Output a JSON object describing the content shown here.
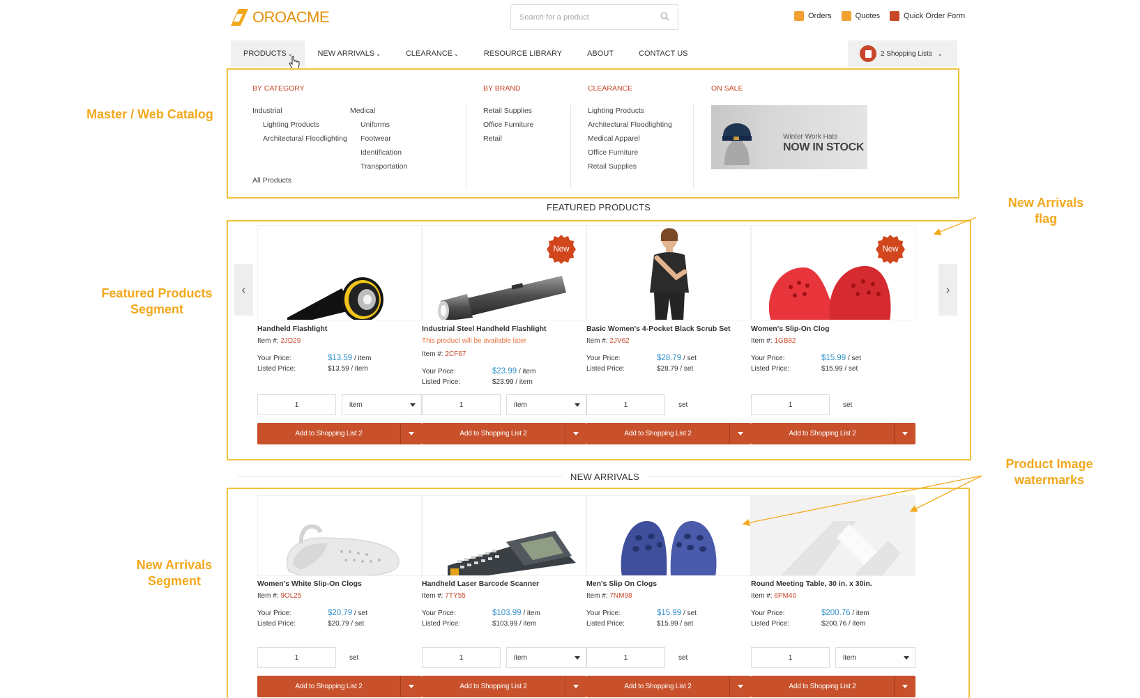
{
  "brand": {
    "name": "OROACME"
  },
  "search": {
    "placeholder": "Search for a product"
  },
  "header_links": [
    {
      "label": "Orders"
    },
    {
      "label": "Quotes"
    },
    {
      "label": "Quick Order Form"
    }
  ],
  "nav": {
    "items": [
      {
        "label": "PRODUCTS"
      },
      {
        "label": "NEW ARRIVALS"
      },
      {
        "label": "CLEARANCE"
      },
      {
        "label": "RESOURCE LIBRARY"
      },
      {
        "label": "ABOUT"
      },
      {
        "label": "CONTACT US"
      }
    ],
    "shopping_lists": "2 Shopping Lists"
  },
  "mega_menu": {
    "by_category": {
      "heading": "BY CATEGORY",
      "industrial": "Industrial",
      "industrial_children": [
        "Lighting Products",
        "Architectural Floodlighting"
      ],
      "medical": "Medical",
      "medical_children": [
        "Uniforms",
        "Footwear",
        "Identification",
        "Transportation"
      ],
      "all_products": "All Products"
    },
    "by_brand": {
      "heading": "BY BRAND",
      "items": [
        "Retail Supplies",
        "Office Furniture",
        "Retail"
      ]
    },
    "clearance": {
      "heading": "CLEARANCE",
      "items": [
        "Lighting Products",
        "Architectural Floodlighting",
        "Medical Apparel",
        "Office Furniture",
        "Retail Supplies"
      ]
    },
    "on_sale": {
      "heading": "ON SALE",
      "promo_line1": "Winter Work Hats",
      "promo_line2": "NOW IN STOCK"
    }
  },
  "labels": {
    "item_no": "Item #:",
    "your_price": "Your Price:",
    "listed_price": "Listed Price:",
    "add_button": "Add to Shopping List 2",
    "new_badge": "New",
    "qty": "1"
  },
  "featured": {
    "title": "FEATURED PRODUCTS",
    "products": [
      {
        "name": "Handheld Flashlight",
        "sku": "2JD29",
        "price": "$13.59",
        "price_unit": "/ item",
        "listed": "$13.59 / item",
        "unit": "item",
        "unit_select": false,
        "badge": false,
        "availability": ""
      },
      {
        "name": "Industrial Steel Handheld Flashlight",
        "sku": "2CF67",
        "price": "$23.99",
        "price_unit": "/ item",
        "listed": "$23.99 / item",
        "unit": "item",
        "unit_select": true,
        "badge": true,
        "availability": "This product will be available later"
      },
      {
        "name": "Basic Women's 4-Pocket Black Scrub Set",
        "sku": "2JV62",
        "price": "$28.79",
        "price_unit": "/ set",
        "listed": "$28.79 / set",
        "unit": "set",
        "unit_select": false,
        "badge": false,
        "availability": ""
      },
      {
        "name": "Women's Slip-On Clog",
        "sku": "1GB82",
        "price": "$15.99",
        "price_unit": "/ set",
        "listed": "$15.99 / set",
        "unit": "set",
        "unit_select": false,
        "badge": true,
        "availability": ""
      }
    ]
  },
  "new_arrivals": {
    "title": "NEW ARRIVALS",
    "products": [
      {
        "name": "Women's White Slip-On Clogs",
        "sku": "9OL25",
        "price": "$20.79",
        "price_unit": "/ set",
        "listed": "$20.79 / set",
        "unit": "set",
        "unit_select": false
      },
      {
        "name": "Handheld Laser Barcode Scanner",
        "sku": "7TY55",
        "price": "$103.99",
        "price_unit": "/ item",
        "listed": "$103.99 / item",
        "unit": "item",
        "unit_select": true
      },
      {
        "name": "Men's Slip On Clogs",
        "sku": "7NM98",
        "price": "$15.99",
        "price_unit": "/ set",
        "listed": "$15.99 / set",
        "unit": "set",
        "unit_select": false
      },
      {
        "name": "Round Meeting Table, 30 in. x 30in.",
        "sku": "6PM40",
        "price": "$200.76",
        "price_unit": "/ item",
        "listed": "$200.76 / item",
        "unit": "item",
        "unit_select": true
      }
    ]
  },
  "annotations": {
    "master_catalog": "Master / Web Catalog",
    "featured_segment_1": "Featured Products",
    "featured_segment_2": "Segment",
    "new_arrivals_flag_1": "New Arrivals",
    "new_arrivals_flag_2": "flag",
    "watermarks_1": "Product Image",
    "watermarks_2": "watermarks",
    "new_arrivals_segment_1": "New Arrivals",
    "new_arrivals_segment_2": "Segment"
  },
  "colors": {
    "accent": "#c8512b",
    "annotation": "#f2a81d",
    "link_price": "#2f8ecb"
  }
}
